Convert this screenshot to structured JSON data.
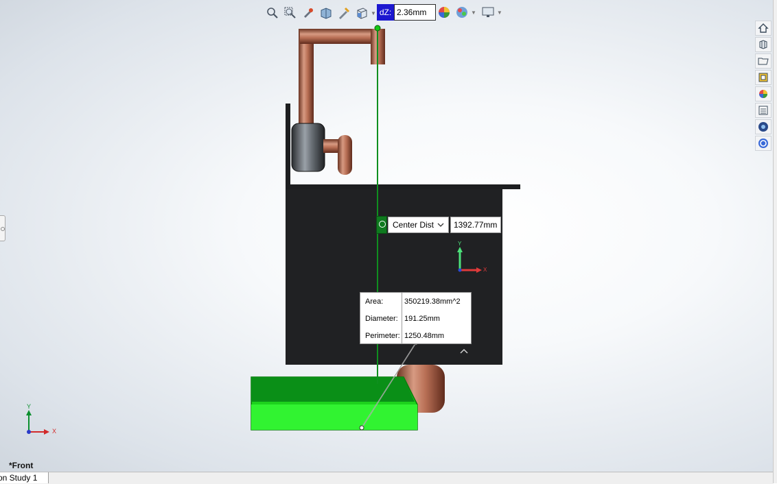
{
  "hud": {
    "dz_label": "dZ:",
    "dz_value": "2.36mm",
    "icons": [
      "zoom-to-fit-icon",
      "zoom-area-icon",
      "previous-view-icon",
      "section-view-icon",
      "dynamic-annotation-icon",
      "view-orientation-icon",
      "display-style-icon",
      "hide-show-icon",
      "edit-appearance-icon",
      "apply-scene-icon",
      "view-settings-icon"
    ]
  },
  "task_pane": {
    "icons": [
      "home-icon",
      "parts-library-icon",
      "file-explorer-icon",
      "view-palette-icon",
      "appearances-icon",
      "custom-properties-icon",
      "solidworks-forum-icon",
      "refresh-icon"
    ]
  },
  "measure": {
    "center_dist_label": "Center Dist",
    "center_dist_value": "1392.77mm",
    "rows": [
      {
        "label": "Area:",
        "value": "350219.38mm^2"
      },
      {
        "label": "Diameter:",
        "value": "191.25mm"
      },
      {
        "label": "Perimeter:",
        "value": "1250.48mm"
      }
    ]
  },
  "triad": {
    "y": "Y",
    "x": "X"
  },
  "view_name": "*Front",
  "bottom_tab": "on Study 1",
  "colors": {
    "highlight_green": "#22ee22",
    "body_dark": "#1f2022",
    "copper": "#b87056",
    "measure_line": "#0f8f1f"
  }
}
